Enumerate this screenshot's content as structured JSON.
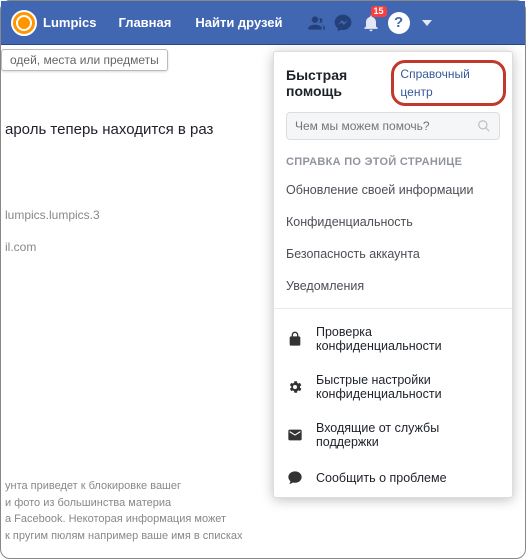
{
  "topbar": {
    "brand": "Lumpics",
    "home": "Главная",
    "find_friends": "Найти друзей",
    "notif_badge": "15"
  },
  "search_fragment": "одей, места или предметы",
  "content": {
    "line1": "ароль теперь находится в раз",
    "user": "lumpics.lumpics.3",
    "email": "il.com"
  },
  "footer": "унта приведет к блокировке вашег\nи фото из большинства материа\nа Facebook. Некоторая информация может\nк пругим пюлям например ваше имя в списках",
  "panel": {
    "title": "Быстрая помощь",
    "help_center": "Справочный центр",
    "search_placeholder": "Чем мы можем помочь?",
    "section": "СПРАВКА ПО ЭТОЙ СТРАНИЦЕ",
    "items": [
      "Обновление своей информации",
      "Конфиденциальность",
      "Безопасность аккаунта",
      "Уведомления"
    ],
    "actions": [
      "Проверка конфиденциальности",
      "Быстрые настройки конфиденциальности",
      "Входящие от службы поддержки",
      "Сообщить о проблеме"
    ]
  }
}
